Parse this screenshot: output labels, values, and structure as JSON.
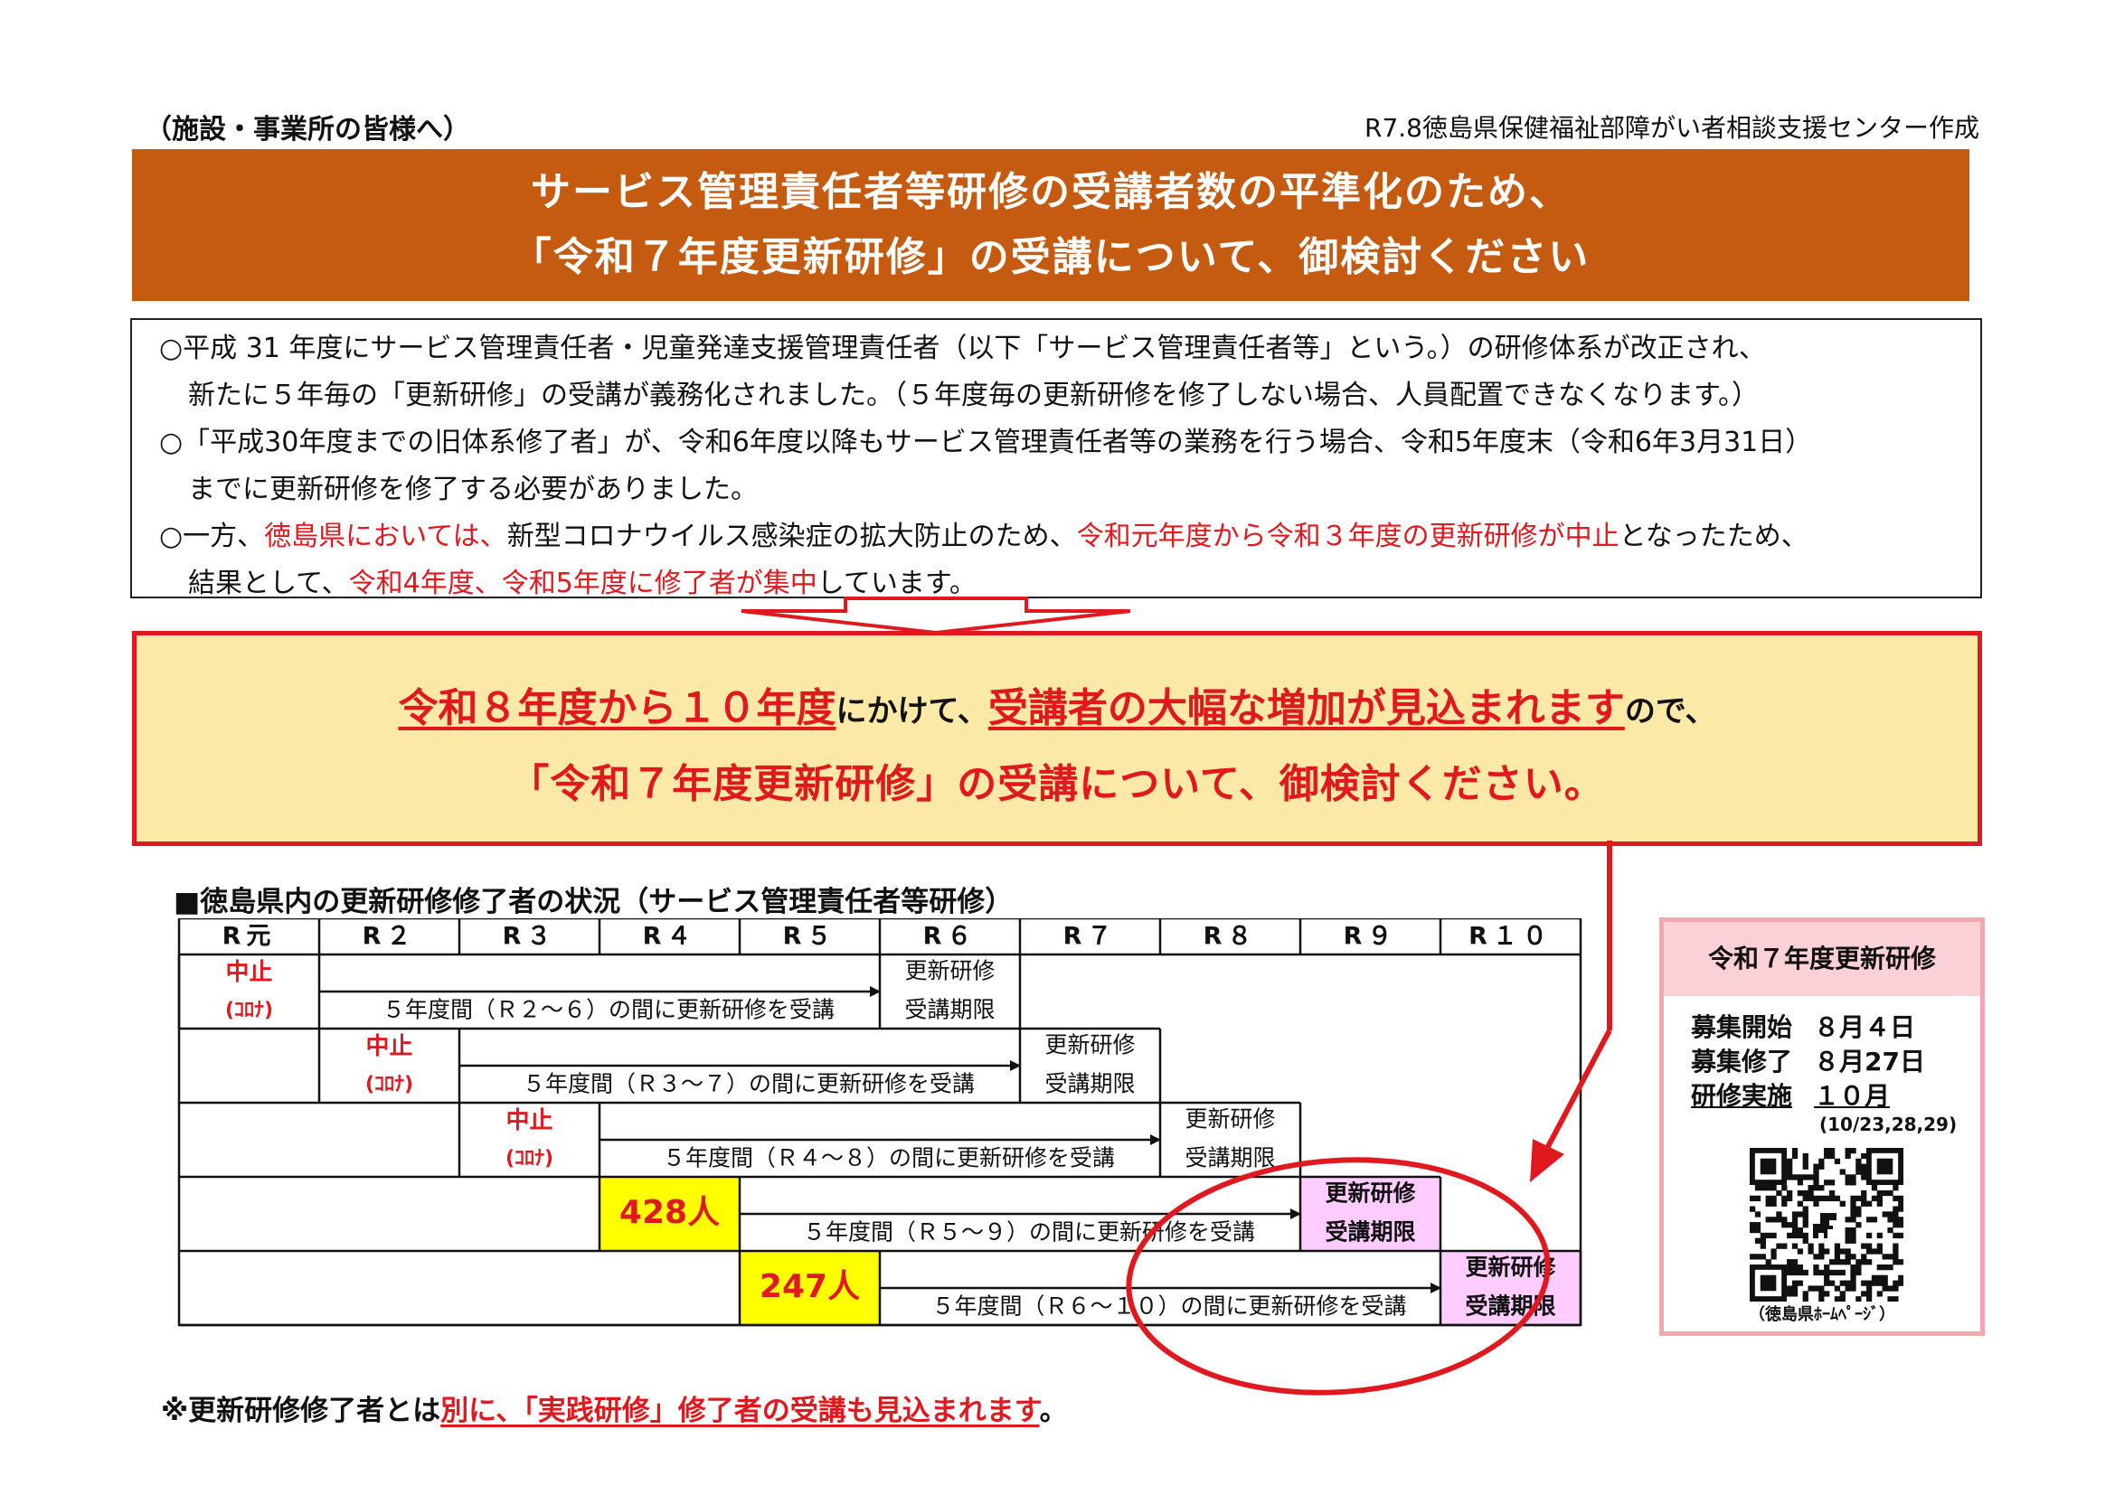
{
  "header": {
    "left": "（施設・事業所の皆様へ）",
    "right": "R7.8徳島県保健福祉部障がい者相談支援センター作成"
  },
  "title": {
    "line1": "サービス管理責任者等研修の受講者数の平準化のため、",
    "line2": "「令和７年度更新研修」の受講について、御検討ください"
  },
  "background": {
    "p1a": "○平成 31 年度にサービス管理責任者・児童発達支援管理責任者（以下「サービス管理責任者等」という。）の研修体系が改正され、",
    "p1b": "新たに５年毎の「更新研修」の受講が義務化されました。（５年度毎の更新研修を修了しない場合、人員配置できなくなります。）",
    "p2a": "○「平成30年度までの旧体系修了者」が、令和6年度以降もサービス管理責任者等の業務を行う場合、令和5年度末（令和6年3月31日）",
    "p2b": "までに更新研修を修了する必要がありました。",
    "p3a_1": "○一方、",
    "p3a_2": "徳島県においては、",
    "p3a_3": "新型コロナウイルス感染症の拡大防止のため、",
    "p3a_4": "令和元年度から令和３年度の更新研修が中止",
    "p3a_5": "となったため、",
    "p3b_1": "結果として、",
    "p3b_2": "令和4年度、令和5年度に修了者が集中",
    "p3b_3": "しています。"
  },
  "highlight": {
    "l1_a": "令和８年度から１０年度",
    "l1_b": "にかけて、",
    "l1_c": "受講者の大幅な増加が見込まれます",
    "l1_d": "ので、",
    "line2": "「令和７年度更新研修」の受講について、御検討ください。"
  },
  "table": {
    "heading": "■徳島県内の更新研修修了者の状況（サービス管理責任者等研修）",
    "columns": [
      "R元",
      "R２",
      "R３",
      "R４",
      "R５",
      "R６",
      "R７",
      "R８",
      "R９",
      "R１０"
    ],
    "suspended": "中止",
    "corona": "(ｺﾛﾅ)",
    "deadline_1": "更新研修",
    "deadline_2": "受講期限",
    "rows": [
      {
        "period": "５年度間（Ｒ２～６）の間に更新研修を受講"
      },
      {
        "period": "５年度間（Ｒ３～７）の間に更新研修を受講"
      },
      {
        "period": "５年度間（Ｒ４～８）の間に更新研修を受講"
      },
      {
        "period": "５年度間（Ｒ５～９）の間に更新研修を受講",
        "count": "428人"
      },
      {
        "period": "５年度間（Ｒ６～１０）の間に更新研修を受講",
        "count": "247人"
      }
    ]
  },
  "note": {
    "a": "※更新研修修了者とは",
    "b": "別に、「実践研修」修了者の受講も見込まれます",
    "c": "。"
  },
  "side": {
    "title": "令和７年度更新研修",
    "rows": [
      {
        "k": "募集開始",
        "v": "８月４日"
      },
      {
        "k": "募集修了",
        "v": "８月27日"
      },
      {
        "k": "研修実施",
        "v": "１０月"
      }
    ],
    "sub": "(10/23,28,29)",
    "caption": "（徳島県ﾎｰﾑﾍﾟｰｼﾞ）"
  },
  "colors": {
    "banner": "#c55a11",
    "red": "#e0191e",
    "highlight_bg": "#fde9a7",
    "count_bg": "#ffff00",
    "deadline_bg": "#ffccff",
    "side_border": "#f4a6ae",
    "side_head_bg": "#fbd1d6"
  },
  "icons": [
    "down-arrow-icon",
    "callout-arrow-icon",
    "qr-code-icon",
    "dinosaur-icon"
  ]
}
